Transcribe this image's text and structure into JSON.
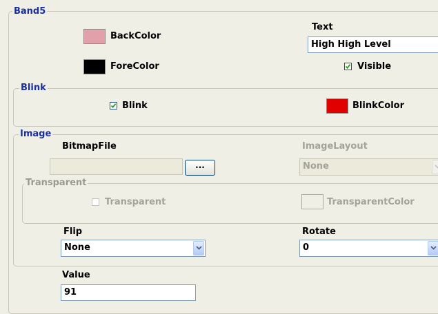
{
  "band5": {
    "title": "Band5",
    "backcolor": {
      "label": "BackColor",
      "color": "#e2a0ab"
    },
    "forecolor": {
      "label": "ForeColor",
      "color": "#000000"
    },
    "text": {
      "label": "Text",
      "value": "High High Level"
    },
    "visible": {
      "label": "Visible",
      "checked": true
    }
  },
  "blink": {
    "title": "Blink",
    "blink_checkbox": {
      "label": "Blink",
      "checked": true
    },
    "blinkcolor": {
      "label": "BlinkColor",
      "color": "#e00000"
    }
  },
  "image": {
    "title": "Image",
    "bitmapfile": {
      "label": "BitmapFile",
      "value": "",
      "browse_label": "..."
    },
    "imagelayout": {
      "label": "ImageLayout",
      "value": "None"
    },
    "transparent_group": {
      "title": "Transparent",
      "checkbox": {
        "label": "Transparent",
        "checked": false
      },
      "color": {
        "label": "TransparentColor",
        "color": "#f0efe6"
      }
    },
    "flip": {
      "label": "Flip",
      "value": "None"
    },
    "rotate": {
      "label": "Rotate",
      "value": "0"
    }
  },
  "value": {
    "label": "Value",
    "value": "91"
  },
  "colors": {
    "legend": "#1a2fa0",
    "background": "#f0efe6",
    "field_border": "#7f9db9",
    "check_mark": "#21a121"
  }
}
